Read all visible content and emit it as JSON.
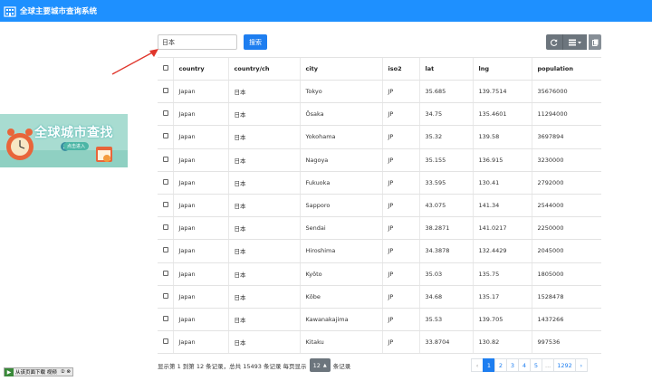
{
  "header": {
    "title": "全球主要城市查询系统"
  },
  "search": {
    "value": "日本",
    "button_label": "搜索"
  },
  "banner": {
    "title": "全球城市查找",
    "subtitle": "点击进入"
  },
  "table": {
    "headers": [
      "country",
      "country/ch",
      "city",
      "iso2",
      "lat",
      "lng",
      "population"
    ],
    "rows": [
      [
        "Japan",
        "日本",
        "Tokyo",
        "JP",
        "35.685",
        "139.7514",
        "35676000"
      ],
      [
        "Japan",
        "日本",
        "Ōsaka",
        "JP",
        "34.75",
        "135.4601",
        "11294000"
      ],
      [
        "Japan",
        "日本",
        "Yokohama",
        "JP",
        "35.32",
        "139.58",
        "3697894"
      ],
      [
        "Japan",
        "日本",
        "Nagoya",
        "JP",
        "35.155",
        "136.915",
        "3230000"
      ],
      [
        "Japan",
        "日本",
        "Fukuoka",
        "JP",
        "33.595",
        "130.41",
        "2792000"
      ],
      [
        "Japan",
        "日本",
        "Sapporo",
        "JP",
        "43.075",
        "141.34",
        "2544000"
      ],
      [
        "Japan",
        "日本",
        "Sendai",
        "JP",
        "38.2871",
        "141.0217",
        "2250000"
      ],
      [
        "Japan",
        "日本",
        "Hiroshima",
        "JP",
        "34.3878",
        "132.4429",
        "2045000"
      ],
      [
        "Japan",
        "日本",
        "Kyōto",
        "JP",
        "35.03",
        "135.75",
        "1805000"
      ],
      [
        "Japan",
        "日本",
        "Kōbe",
        "JP",
        "34.68",
        "135.17",
        "1528478"
      ],
      [
        "Japan",
        "日本",
        "Kawanakajima",
        "JP",
        "35.53",
        "139.705",
        "1437266"
      ],
      [
        "Japan",
        "日本",
        "Kitaku",
        "JP",
        "33.8704",
        "130.82",
        "997536"
      ]
    ]
  },
  "pagination": {
    "info_prefix": "显示第 1 到第 12 条记录，总共 15493 条记录 每页显示",
    "page_size": "12",
    "info_suffix": "条记录",
    "prev": "‹",
    "pages": [
      "1",
      "2",
      "3",
      "4",
      "5",
      "...",
      "1292"
    ],
    "next": "›",
    "active_page": "1"
  },
  "download_widget": {
    "label": "从该页面下载 视频",
    "extra": "② ⊗"
  },
  "colors": {
    "topbar": "#1e90ff",
    "primary": "#1e7ef0",
    "tool": "#6c757d",
    "arrow": "#e0362c"
  },
  "icons": {
    "refresh": "refresh-icon",
    "columns": "columns-icon",
    "export": "export-icon",
    "play": "play-icon"
  }
}
